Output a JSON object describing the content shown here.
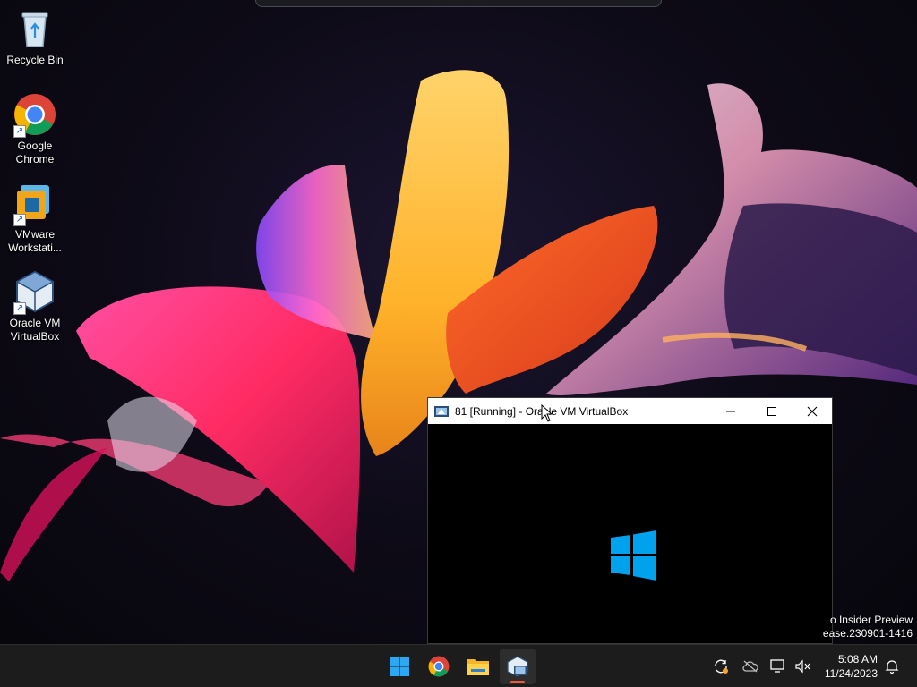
{
  "desktop": {
    "icons": [
      {
        "label": "Recycle Bin",
        "icon": "recycle-bin-icon"
      },
      {
        "label": "Google Chrome",
        "label_lines": [
          "Google",
          "Chrome"
        ],
        "icon": "chrome-icon"
      },
      {
        "label": "VMware Workstati...",
        "label_lines": [
          "VMware",
          "Workstati..."
        ],
        "icon": "vmware-icon"
      },
      {
        "label": "Oracle VM VirtualBox",
        "label_lines": [
          "Oracle VM",
          "VirtualBox"
        ],
        "icon": "virtualbox-icon"
      }
    ]
  },
  "vbox_window": {
    "title": "81 [Running] - Oracle VM VirtualBox",
    "icon": "virtualbox-vm-icon",
    "controls": [
      "minimize-icon",
      "maximize-icon",
      "close-icon"
    ],
    "screen_content": "windows-logo-icon"
  },
  "watermark": {
    "line1": "o Insider Preview",
    "line2": "ease.230901-1416"
  },
  "taskbar": {
    "apps": [
      {
        "name": "start",
        "icon": "windows-start-icon"
      },
      {
        "name": "chrome",
        "icon": "chrome-icon"
      },
      {
        "name": "file-explorer",
        "icon": "folder-icon"
      },
      {
        "name": "virtualbox-vm",
        "icon": "virtualbox-vm-icon",
        "active": true
      }
    ],
    "tray": {
      "icons": [
        "sync-icon",
        "onedrive-offline-icon",
        "network-icon",
        "volume-muted-icon",
        "notification-bell-icon"
      ],
      "time": "5:08 AM",
      "date": "11/24/2023"
    }
  },
  "colors": {
    "windows_blue": "#00a2ed",
    "taskbar": "#1c1c1c",
    "active_indicator": "#f05a3a"
  }
}
